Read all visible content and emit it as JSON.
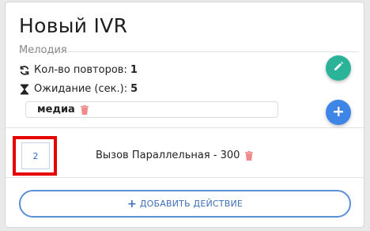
{
  "panel": {
    "title": "Новый IVR",
    "section_label": "Мелодия",
    "repeat_label": "Кол-во повторов:",
    "repeat_value": "1",
    "wait_label": "Ожидание (сек.):",
    "wait_value": "5",
    "media_value": "медиа"
  },
  "actions": [
    {
      "number": "2",
      "label": "Вызов Параллельная - 300"
    }
  ],
  "add_action_label": "ДОБАВИТЬ ДЕЙСТВИЕ",
  "colors": {
    "edit_fab": "#2bb39a",
    "add_fab": "#3d86e8",
    "delete_icon": "#f08a8a",
    "highlight": "#e60000",
    "accent": "#3f6fb5"
  },
  "icons": [
    "sync-icon",
    "hourglass-icon",
    "trash-icon",
    "pencil-icon",
    "plus-icon"
  ]
}
